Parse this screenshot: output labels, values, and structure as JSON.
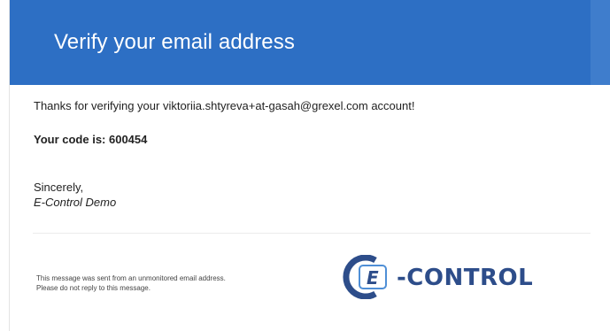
{
  "email": {
    "title": "Verify your email address",
    "thanks_line": "Thanks for verifying your viktoriia.shtyreva+at-gasah@grexel.com account!",
    "code_line": "Your code is: 600454",
    "closing": "Sincerely,",
    "signature": "E-Control Demo",
    "footer": {
      "line1": "This message was sent from an unmonitored email address.",
      "line2": "Please do not reply to this message."
    },
    "logo": {
      "text": "-CONTROL",
      "letter": "E",
      "icon": "e-control-logo-icon"
    }
  },
  "colors": {
    "banner": "#2d6fc4",
    "logo_dark": "#2d4d8a",
    "logo_light": "#4f8fd6"
  }
}
